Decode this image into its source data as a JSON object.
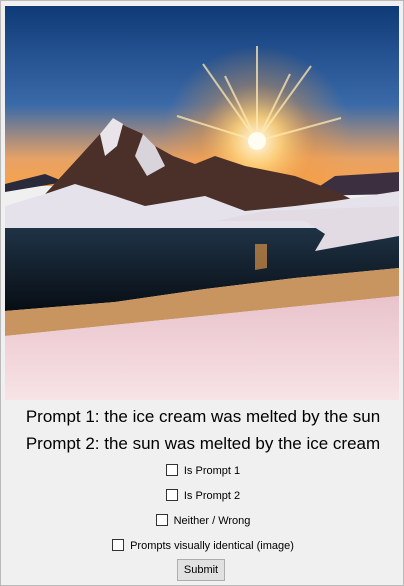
{
  "image": {
    "subject": "mountain-lake-sunset",
    "colors": {
      "sky_top": "#0f3a78",
      "sky_mid": "#3b6aa8",
      "horizon": "#f6a24a",
      "sun": "#fff6d6",
      "snow": "#f3d6dc",
      "lake": "#0b1822",
      "rock": "#4a3028"
    }
  },
  "prompts": {
    "prompt1": "Prompt 1: the ice cream was melted by the sun",
    "prompt2": "Prompt 2: the sun was melted by the ice cream"
  },
  "options": {
    "is_prompt_1": "Is Prompt 1",
    "is_prompt_2": "Is Prompt 2",
    "neither": "Neither / Wrong",
    "identical": "Prompts visually identical (image)"
  },
  "submit_label": "Submit"
}
